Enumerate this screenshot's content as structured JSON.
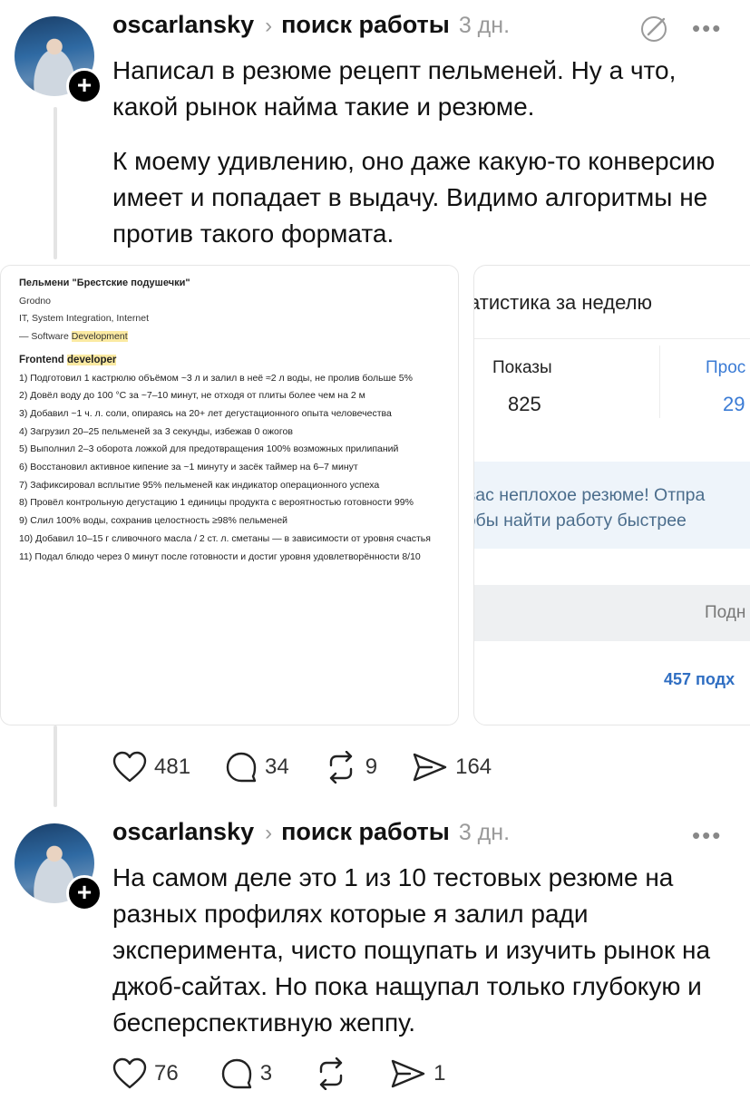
{
  "post1": {
    "username": "oscarlansky",
    "topic": "поиск работы",
    "time": "3 дн.",
    "more": "•••",
    "paragraph1": "Написал в резюме рецепт пельменей. Ну а что, какой рынок найма такие и резюме.",
    "paragraph2": "К моему удивлению, оно даже какую-то конверсию имеет и попадает в выдачу. Видимо алгоритмы не против такого формата.",
    "resume": {
      "title": "Пельмени \"Брестские подушечки\"",
      "city": "Grodno",
      "industry": "IT, System Integration, Internet",
      "spec_prefix": "— Software ",
      "spec_highlight": "Development",
      "role_prefix": "Frontend ",
      "role_highlight": "developer",
      "items": [
        "1) Подготовил 1 кастрюлю объёмом ~3 л и залил в неё ≈2 л воды, не пролив больше 5%",
        "2) Довёл воду до 100 °С за ~7–10 минут, не отходя от плиты более чем на 2 м",
        "3) Добавил ~1 ч. л. соли, опираясь на 20+ лет дегустационного опыта человечества",
        "4) Загрузил 20–25 пельменей за 3 секунды, избежав 0 ожогов",
        "5) Выполнил 2–3 оборота ложкой для предотвращения 100% возможных прилипаний",
        "6) Восстановил активное кипение за ~1 минуту и засёк таймер на 6–7 минут",
        "7) Зафиксировал всплытие 95% пельменей как индикатор операционного успеха",
        "8) Провёл контрольную дегустацию 1 единицы продукта с вероятностью готовности 99%",
        "9) Слил 100% воды, сохранив целостность ≥98% пельменей",
        "10) Добавил 10–15 г сливочного масла / 2 ст. л. сметаны — в зависимости от уровня счастья",
        "11) Подал блюдо через 0 минут после готовности и достиг уровня удовлетворённости 8/10"
      ]
    },
    "stats": {
      "title": "атистика за неделю",
      "views_label": "Показы",
      "views_value": "825",
      "second_label": "Прос",
      "second_value": "29",
      "promo_line1": "' вас неплохое резюме! Отпра",
      "promo_line2": "тобы найти работу быстрее",
      "button_label": "Подн",
      "subs_text": "457 подх"
    },
    "likes": "481",
    "comments": "34",
    "reposts": "9",
    "shares": "164"
  },
  "post2": {
    "username": "oscarlansky",
    "topic": "поиск работы",
    "time": "3 дн.",
    "more": "•••",
    "paragraph1": "На самом деле это 1 из 10 тестовых резюме на разных профилях которые я залил ради эксперимента, чисто пощупать и изучить рынок на джоб-сайтах. Но пока нащупал только глубокую и бесперспективную жеппу.",
    "likes": "76",
    "comments": "3",
    "shares": "1"
  }
}
